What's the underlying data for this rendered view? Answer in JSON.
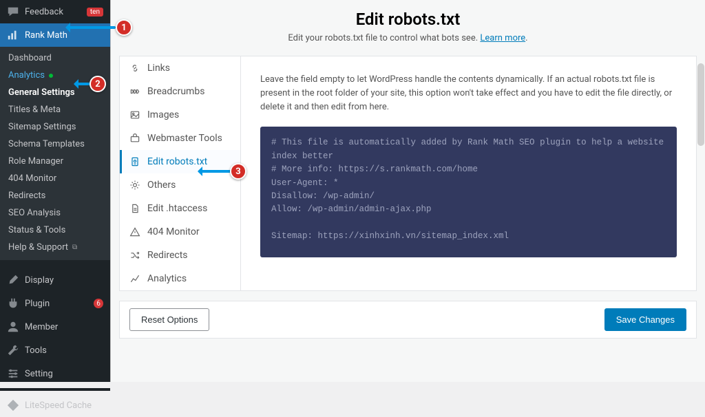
{
  "wp_sidebar": {
    "feedback": {
      "label": "Feedback",
      "badge": "ten"
    },
    "rankmath": {
      "label": "Rank Math"
    },
    "submenu": {
      "dashboard": "Dashboard",
      "analytics": "Analytics",
      "general_settings": "General Settings",
      "titles_meta": "Titles & Meta",
      "sitemap_settings": "Sitemap Settings",
      "schema_templates": "Schema Templates",
      "role_manager": "Role Manager",
      "404_monitor": "404 Monitor",
      "redirects": "Redirects",
      "seo_analysis": "SEO Analysis",
      "status_tools": "Status & Tools",
      "help_support": "Help & Support"
    },
    "display": "Display",
    "plugin": {
      "label": "Plugin",
      "count": "6"
    },
    "member": "Member",
    "tools": "Tools",
    "setting": "Setting",
    "litespeed": "LiteSpeed Cache"
  },
  "header": {
    "title": "Edit robots.txt",
    "subtitle_pre": "Edit your robots.txt file to control what bots see. ",
    "learn_more": "Learn more",
    "subtitle_post": "."
  },
  "tabs": {
    "links": "Links",
    "breadcrumbs": "Breadcrumbs",
    "images": "Images",
    "webmaster": "Webmaster Tools",
    "edit_robots": "Edit robots.txt",
    "others": "Others",
    "htaccess": "Edit .htaccess",
    "404": "404 Monitor",
    "redirects": "Redirects",
    "analytics": "Analytics"
  },
  "content": {
    "description": "Leave the field empty to let WordPress handle the contents dynamically. If an actual robots.txt file is present in the root folder of your site, this option won't take effect and you have to edit the file directly, or delete it and then edit from here.",
    "editor_text": "# This file is automatically added by Rank Math SEO plugin to help a website index better\n# More info: https://s.rankmath.com/home\nUser-Agent: *\nDisallow: /wp-admin/\nAllow: /wp-admin/admin-ajax.php\n\nSitemap: https://xinhxinh.vn/sitemap_index.xml"
  },
  "footer": {
    "reset": "Reset Options",
    "save": "Save Changes"
  },
  "callouts": {
    "1": "1",
    "2": "2",
    "3": "3"
  }
}
